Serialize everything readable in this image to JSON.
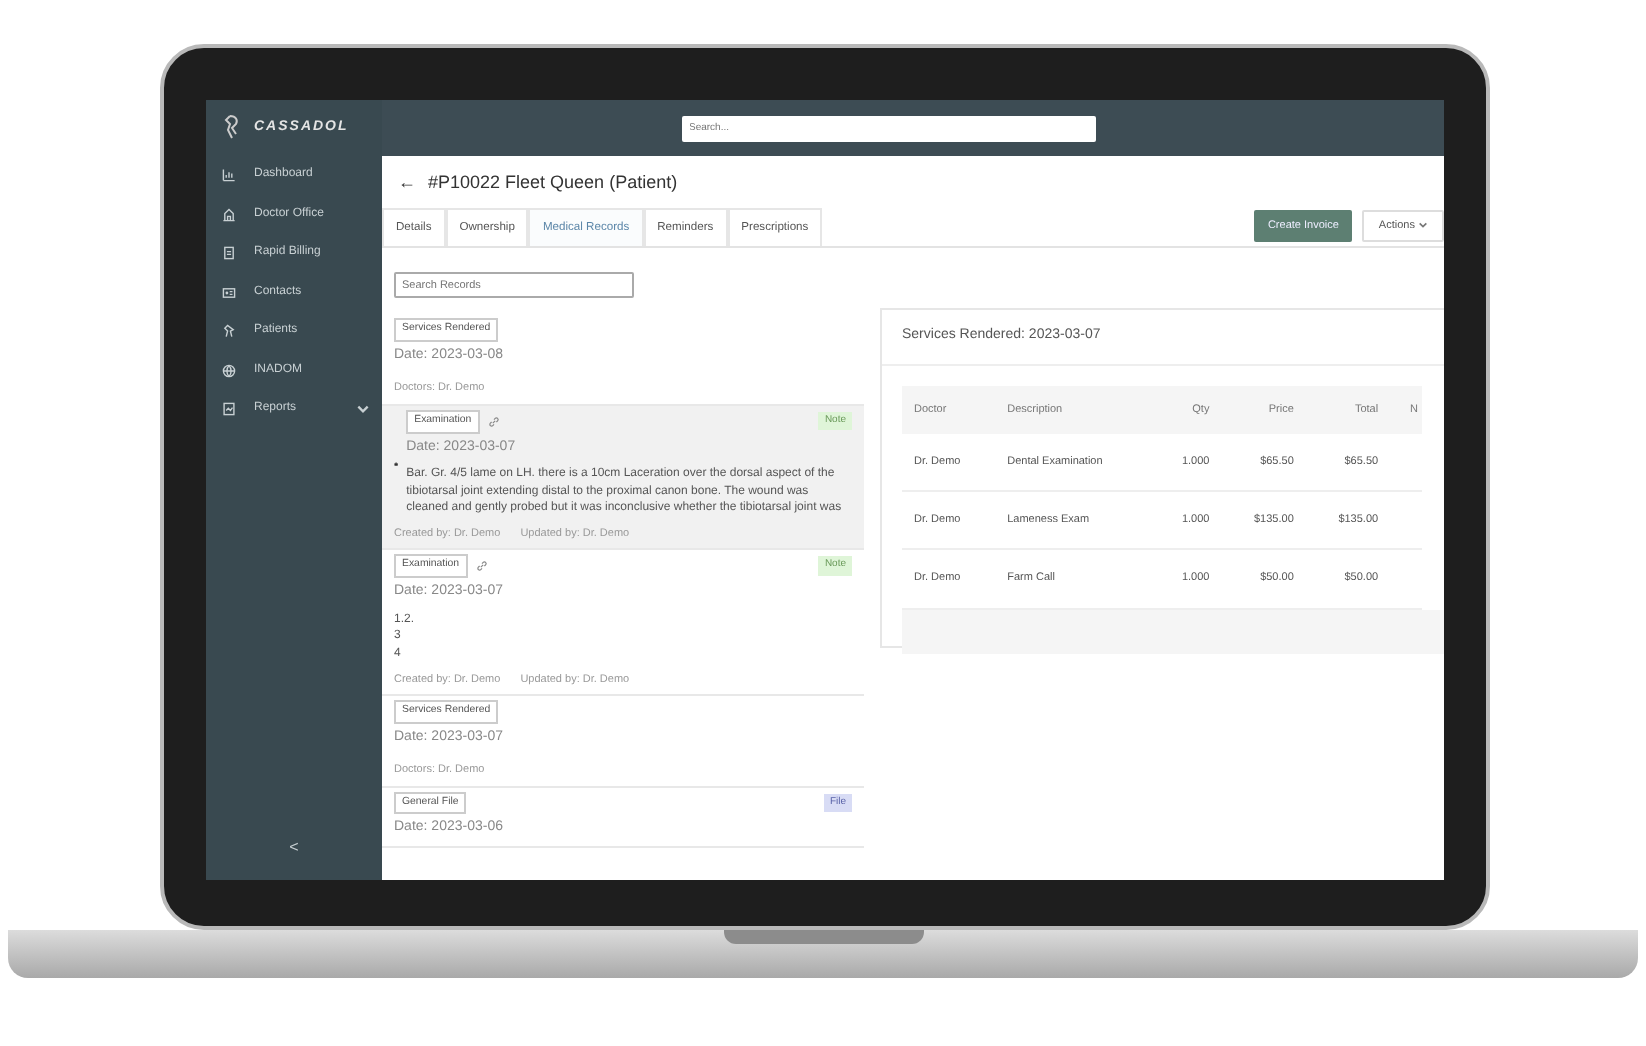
{
  "app": {
    "logo": "CASSADOL"
  },
  "search": {
    "placeholder": "Search..."
  },
  "sidebar": {
    "items": [
      {
        "label": "Dashboard",
        "expandable": false
      },
      {
        "label": "Doctor Office",
        "expandable": false
      },
      {
        "label": "Rapid Billing",
        "expandable": false
      },
      {
        "label": "Contacts",
        "expandable": false
      },
      {
        "label": "Patients",
        "expandable": false
      },
      {
        "label": "INADOM",
        "expandable": false
      },
      {
        "label": "Reports",
        "expandable": true
      }
    ],
    "collapse": "<"
  },
  "page": {
    "back": "←",
    "title": "#P10022 Fleet Queen (Patient)"
  },
  "tabs": [
    {
      "label": "Details",
      "selected": false
    },
    {
      "label": "Ownership",
      "selected": false
    },
    {
      "label": "Medical Records",
      "selected": true
    },
    {
      "label": "Reminders",
      "selected": false
    },
    {
      "label": "Prescriptions",
      "selected": false
    }
  ],
  "actions": {
    "create": "Create Invoice",
    "menu": "Actions"
  },
  "record_search": {
    "placeholder": "Search Records"
  },
  "records": [
    {
      "kind": "services",
      "selected": false,
      "tag": "Services Rendered",
      "date": "Date: 2023-03-08",
      "doctors": "Doctors: Dr. Demo"
    },
    {
      "kind": "note",
      "selected": true,
      "camera": true,
      "tag": "Examination",
      "badge": "Note",
      "color": "#dff5d8",
      "date": "Date: 2023-03-07",
      "lines": [
        "Bar. Gr. 4/5 lame on LH. there is a 10cm Laceration over the dorsal aspect of the tibiotarsal joint extending distal to the proximal canon bone. The wound was cleaned and gently probed but it was inconclusive whether the tibiotarsal joint was"
      ],
      "created": "Created by: Dr. Demo",
      "updated": "Updated by: Dr. Demo"
    },
    {
      "kind": "note",
      "selected": false,
      "camera": false,
      "tag": "Examination",
      "badge": "Note",
      "color": "#dff5d8",
      "date": "Date: 2023-03-07",
      "lines": [
        "1.2.",
        "3",
        "4"
      ],
      "created": "Created by: Dr. Demo",
      "updated": "Updated by: Dr. Demo"
    },
    {
      "kind": "services",
      "selected": false,
      "tag": "Services Rendered",
      "date": "Date: 2023-03-07",
      "doctors": "Doctors: Dr. Demo"
    },
    {
      "kind": "file",
      "selected": false,
      "tag": "General File",
      "badge": "File",
      "color": "#d8dcf5",
      "date": "Date: 2023-03-06"
    }
  ],
  "services_panel": {
    "title": "Services Rendered: 2023-03-07",
    "table": {
      "columns": [
        "Doctor",
        "Description",
        "Qty",
        "Price",
        "Total",
        "N"
      ],
      "rows": [
        [
          "Dr. Demo",
          "Dental Examination",
          "1.000",
          "$65.50",
          "$65.50"
        ],
        [
          "Dr. Demo",
          "Lameness Exam",
          "1.000",
          "$135.00",
          "$135.00"
        ],
        [
          "Dr. Demo",
          "Farm Call",
          "1.000",
          "$50.00",
          "$50.00"
        ]
      ]
    }
  }
}
